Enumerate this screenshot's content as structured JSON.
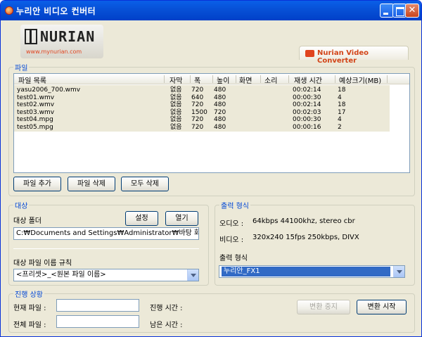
{
  "window": {
    "title": "누리안 비디오 컨버터"
  },
  "logo": {
    "name": "NURIAN",
    "url": "www.mynurian.com"
  },
  "product": {
    "name": "Nurian Video Converter"
  },
  "files": {
    "legend": "파일",
    "columns": [
      "파일 목록",
      "자막",
      "폭",
      "높이",
      "화면",
      "소리",
      "재생 시간",
      "예상크기(MB)"
    ],
    "rows": [
      {
        "name": "yasu2006_700.wmv",
        "subtitle": "없음",
        "width": "720",
        "height": "480",
        "screen": "",
        "sound": "",
        "duration": "00:02:14",
        "size": "18"
      },
      {
        "name": "test01.wmv",
        "subtitle": "없음",
        "width": "640",
        "height": "480",
        "screen": "",
        "sound": "",
        "duration": "00:00:30",
        "size": "4"
      },
      {
        "name": "test02.wmv",
        "subtitle": "없음",
        "width": "720",
        "height": "480",
        "screen": "",
        "sound": "",
        "duration": "00:02:14",
        "size": "18"
      },
      {
        "name": "test03.wmv",
        "subtitle": "없음",
        "width": "1500",
        "height": "720",
        "screen": "",
        "sound": "",
        "duration": "00:02:03",
        "size": "17"
      },
      {
        "name": "test04.mpg",
        "subtitle": "없음",
        "width": "720",
        "height": "480",
        "screen": "",
        "sound": "",
        "duration": "00:00:30",
        "size": "4"
      },
      {
        "name": "test05.mpg",
        "subtitle": "없음",
        "width": "720",
        "height": "480",
        "screen": "",
        "sound": "",
        "duration": "00:00:16",
        "size": "2"
      }
    ],
    "add_button": "파일 추가",
    "delete_button": "파일 삭제",
    "delete_all_button": "모두 삭제"
  },
  "target": {
    "legend": "대상",
    "folder_label": "대상 폴더",
    "set_button": "설정",
    "open_button": "열기",
    "folder_value": "C:₩Documents and Settings₩Administrator₩바탕 화면₩N",
    "rule_label": "대상 파일 이름 규칙",
    "rule_value": "<프리셋>_<원본 파일 이름>"
  },
  "output": {
    "legend": "출력 형식",
    "audio_label": "오디오 :",
    "audio_value": "64kbps 44100khz, stereo cbr",
    "video_label": "비디오 :",
    "video_value": "320x240 15fps 250kbps, DIVX",
    "format_label": "출력 형식",
    "format_value": "누리안_FX1"
  },
  "progress": {
    "legend": "진행 상황",
    "current_file_label": "현재 파일 :",
    "current_file_value": "",
    "total_file_label": "전체 파일 :",
    "total_file_value": "",
    "elapsed_label": "진행 시간 :",
    "remaining_label": "남은 시간 :",
    "stop_button": "변환 중지",
    "start_button": "변환 시작"
  },
  "colors": {
    "accent": "#0046D5",
    "selection": "#316AC5",
    "brand": "#D24418"
  }
}
